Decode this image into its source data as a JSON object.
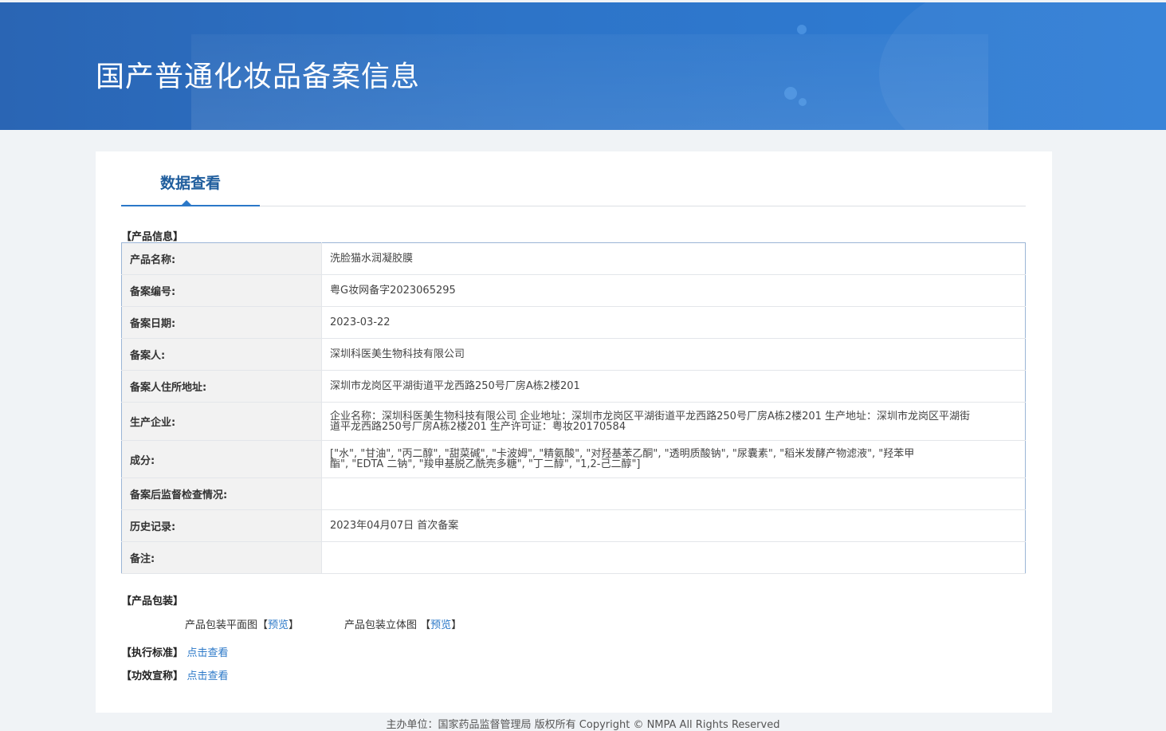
{
  "header": {
    "title": "国产普通化妆品备案信息"
  },
  "tab": {
    "label": "数据查看"
  },
  "product_info": {
    "section_title": "【产品信息】",
    "rows": [
      {
        "key": "产品名称:",
        "value": "洗脸猫水润凝胶膜"
      },
      {
        "key": "备案编号:",
        "value": "粤G妆网备字2023065295"
      },
      {
        "key": "备案日期:",
        "value": "2023-03-22"
      },
      {
        "key": "备案人:",
        "value": "深圳科医美生物科技有限公司"
      },
      {
        "key": "备案人住所地址:",
        "value": "深圳市龙岗区平湖街道平龙西路250号厂房A栋2楼201"
      },
      {
        "key": "生产企业:",
        "value_lines": [
          "企业名称：深圳科医美生物科技有限公司 企业地址：深圳市龙岗区平湖街道平龙西路250号厂房A栋2楼201 生产地址：深圳市龙岗区平湖街",
          "道平龙西路250号厂房A栋2楼201 生产许可证：粤妆20170584"
        ]
      },
      {
        "key": "成分:",
        "value_lines": [
          "[\"水\", \"甘油\", \"丙二醇\", \"甜菜碱\", \"卡波姆\", \"精氨酸\", \"对羟基苯乙酮\", \"透明质酸钠\", \"尿囊素\", \"稻米发酵产物滤液\", \"羟苯甲",
          "酯\", \"EDTA 二钠\", \"羧甲基脱乙酰壳多糖\", \"丁二醇\", \"1,2-己二醇\"]"
        ]
      },
      {
        "key": "备案后监督检查情况:",
        "value": ""
      },
      {
        "key": "历史记录:",
        "value": "2023年04月07日 首次备案"
      },
      {
        "key": "备注:",
        "value": ""
      }
    ]
  },
  "packaging": {
    "section_title": "【产品包装】",
    "flat_label": "产品包装平面图",
    "flat_link": "预览",
    "solid_label": "产品包装立体图",
    "solid_link": "预览",
    "bracket_open": "【",
    "bracket_close": "】"
  },
  "standard": {
    "section_title": "【执行标准】",
    "link": "点击查看"
  },
  "efficacy": {
    "section_title": "【功效宣称】",
    "link": "点击查看"
  },
  "footer": {
    "text": "主办单位：国家药品监督管理局 版权所有 Copyright © NMPA All Rights Reserved"
  }
}
